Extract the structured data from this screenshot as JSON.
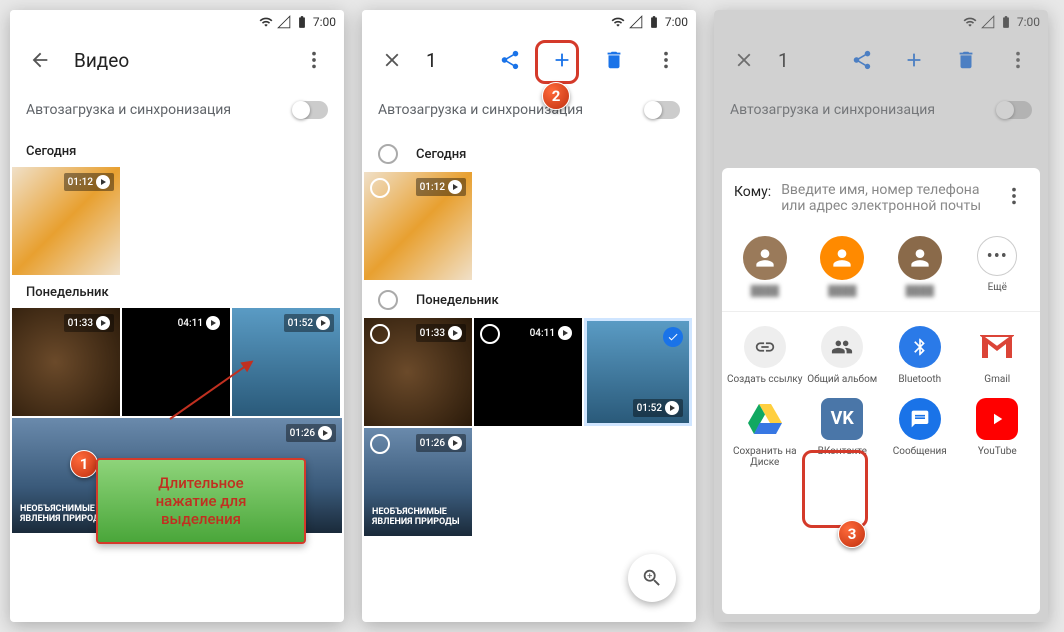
{
  "status": {
    "time": "7:00"
  },
  "panel1": {
    "title": "Видео",
    "autobackup": "Автозагрузка и синхронизация",
    "today": "Сегодня",
    "monday": "Понедельник",
    "durations": {
      "d1": "01:12",
      "d2": "01:33",
      "d3": "04:11",
      "d4": "01:52",
      "d5": "01:26"
    },
    "mtn1": "НЕОБЪЯСНИМЫЕ",
    "mtn2": "ЯВЛЕНИЯ ПРИРОДЫ",
    "callout": "Длительное\nнажатие для\nвыделения"
  },
  "panel2": {
    "count": "1",
    "autobackup": "Автозагрузка и синхронизация",
    "today": "Сегодня",
    "monday": "Понедельник",
    "durations": {
      "d1": "01:12",
      "d2": "01:33",
      "d3": "04:11",
      "d4": "01:52",
      "d5": "01:26"
    },
    "mtn1": "НЕОБЪЯСНИМЫЕ",
    "mtn2": "ЯВЛЕНИЯ ПРИРОДЫ"
  },
  "panel3": {
    "count": "1",
    "autobackup": "Автозагрузка и синхронизация",
    "share_to_label": "Кому:",
    "share_to_hint": "Введите имя, номер телефона или адрес электронной почты",
    "more": "Ещё",
    "apps": {
      "link": "Создать ссылку",
      "album": "Общий альбом",
      "bluetooth": "Bluetooth",
      "gmail": "Gmail",
      "drive": "Сохранить на Диске",
      "vk": "ВКонтакте",
      "messages": "Сообщения",
      "youtube": "YouTube"
    }
  },
  "badges": {
    "n1": "1",
    "n2": "2",
    "n3": "3"
  }
}
